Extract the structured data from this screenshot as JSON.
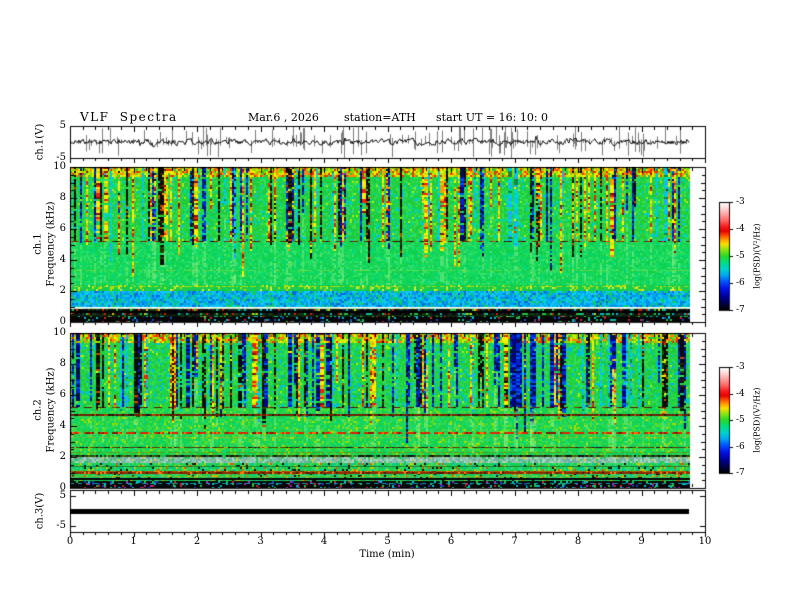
{
  "header": {
    "title": "VLF Spectra",
    "date": "Mar.6 , 2026",
    "station": "station=ATH",
    "start_ut": "start UT =  16: 10: 0"
  },
  "x_axis": {
    "label": "Time (min)",
    "ticks": [
      "0",
      "1",
      "2",
      "3",
      "4",
      "5",
      "6",
      "7",
      "8",
      "9",
      "10"
    ],
    "minor_per_major": 5
  },
  "panels": {
    "ch1_wave": {
      "ylabel": "ch.1(V)",
      "yticks": [
        "5",
        "-5"
      ]
    },
    "spec1": {
      "ylabel_channel": "ch.1",
      "ylabel_axis": "Frequency (kHz)",
      "yticks": [
        "10",
        "8",
        "6",
        "4",
        "2",
        "0"
      ]
    },
    "spec2": {
      "ylabel_channel": "ch.2",
      "ylabel_axis": "Frequency (kHz)",
      "yticks": [
        "10",
        "8",
        "6",
        "4",
        "2",
        "0"
      ]
    },
    "ch3_wave": {
      "ylabel": "ch.3(V)",
      "yticks": [
        "5",
        "-5"
      ]
    }
  },
  "colorbar": {
    "label": "log(PSD)(V²/Hz)",
    "ticks": [
      "-3",
      "-4",
      "-5",
      "-6",
      "-7"
    ],
    "gradient": [
      [
        0.0,
        "#ffffff"
      ],
      [
        0.04,
        "#ffe8e8"
      ],
      [
        0.1,
        "#ffb0b0"
      ],
      [
        0.17,
        "#ff6868"
      ],
      [
        0.23,
        "#f81818"
      ],
      [
        0.27,
        "#e80000"
      ],
      [
        0.31,
        "#ff4c00"
      ],
      [
        0.35,
        "#ffa000"
      ],
      [
        0.39,
        "#f8e000"
      ],
      [
        0.44,
        "#90e410"
      ],
      [
        0.5,
        "#28d828"
      ],
      [
        0.56,
        "#00dc80"
      ],
      [
        0.62,
        "#00d4cc"
      ],
      [
        0.68,
        "#00a4f0"
      ],
      [
        0.74,
        "#0050ff"
      ],
      [
        0.8,
        "#0014e8"
      ],
      [
        0.87,
        "#0000a0"
      ],
      [
        0.93,
        "#000050"
      ],
      [
        1.0,
        "#000000"
      ]
    ]
  },
  "chart_data": [
    {
      "type": "line",
      "name": "ch1_waveform",
      "ylabel": "ch.1(V)",
      "xlim": [
        0,
        10
      ],
      "ylim": [
        -5,
        5
      ],
      "yticks": [
        5,
        -5
      ],
      "description": "Noisy broadband ch.1 time series ~0.5-1 V rms about 0 V with frequent impulsive sferic spikes reaching +/-5 V, data extends 0 to ~9.75 min",
      "render": {
        "seed": 20260306,
        "ar": 0.55,
        "step_v": 1.5,
        "clamp_v": 4.8,
        "spike_count": 170,
        "spike_min_v": 0.5,
        "spike_max_v": 4.6,
        "trace_color": "#111111",
        "spike_color": "#7d7d7d"
      }
    },
    {
      "type": "heatmap",
      "name": "ch1_spectrogram",
      "channel": "ch.1",
      "ylabel": "Frequency (kHz)",
      "xlim": [
        0,
        10
      ],
      "ylim": [
        0,
        10
      ],
      "zlim": [
        -7,
        -3
      ],
      "zlabel": "log(PSD)(V²/Hz)",
      "data_end_min": 9.75,
      "description": "VLF spectrogram: green ~-5 background; dense vertical sferic streaks (yellow/red/black/blue) above ~5.2 kHz; dashed dark-red hiss cutoff line at 5.25 kHz; blue band 1-2 kHz; whitish band ~0.9 kHz; black saturated bands below 0.8 kHz",
      "render": {
        "seed": 420001,
        "regions": [
          {
            "f0": 9.3,
            "f1": 10.01,
            "palette": [
              [
                "#88dd00",
                3
              ],
              [
                "#ccee00",
                2
              ],
              [
                "#ff8800",
                2
              ],
              [
                "#ee3300",
                2
              ],
              [
                "#22cc44",
                2
              ],
              [
                "#ffee00",
                1
              ]
            ]
          },
          {
            "f0": 5.2,
            "f1": 9.3,
            "palette": [
              [
                "#22d344",
                6
              ],
              [
                "#1fc93f",
                4
              ],
              [
                "#35e050",
                3
              ],
              [
                "#00d8a0",
                1.5
              ],
              [
                "#00c8e0",
                0.7
              ],
              [
                "#aaee00",
                0.5
              ]
            ]
          },
          {
            "f0": 2.45,
            "f1": 5.2,
            "palette": [
              [
                "#14d556",
                6
              ],
              [
                "#1edd60",
                4
              ],
              [
                "#0ed04e",
                3
              ],
              [
                "#00d87c",
                2
              ],
              [
                "#3ae06a",
                2
              ]
            ]
          },
          {
            "f0": 2.0,
            "f1": 2.45,
            "palette": [
              [
                "#16d050",
                5
              ],
              [
                "#18c94a",
                4
              ],
              [
                "#bbdd00",
                1
              ],
              [
                "#ddee33",
                0.7
              ]
            ]
          },
          {
            "f0": 1.0,
            "f1": 2.0,
            "palette": [
              [
                "#00aaee",
                3
              ],
              [
                "#0090e8",
                2
              ],
              [
                "#00d0e8",
                2
              ],
              [
                "#18c0ff",
                2
              ],
              [
                "#11cc66",
                2
              ],
              [
                "#0868d8",
                1
              ]
            ]
          },
          {
            "f0": 0.82,
            "f1": 1.0,
            "palette": [
              [
                "#c8e8cc",
                5
              ],
              [
                "#aed8c0",
                3
              ],
              [
                "#e8f4e8",
                2
              ],
              [
                "#ccdd66",
                1
              ]
            ]
          },
          {
            "f0": 0.3,
            "f1": 0.82,
            "palette": [
              [
                "#0a0a0a",
                5
              ],
              [
                "#1a1a2a",
                2
              ],
              [
                "#123a10",
                1.5
              ],
              [
                "#20c040",
                1.2
              ],
              [
                "#00b8c8",
                0.8
              ],
              [
                "#cc2200",
                0.6
              ],
              [
                "#cccc00",
                0.4
              ]
            ]
          },
          {
            "f0": -0.1,
            "f1": 0.3,
            "palette": [
              [
                "#060606",
                8
              ],
              [
                "#00b8d8",
                0.5
              ],
              [
                "#2244cc",
                0.4
              ],
              [
                "#20c040",
                0.4
              ],
              [
                "#cc2233",
                0.2
              ]
            ]
          }
        ],
        "lines": [
          {
            "kHz": 5.25,
            "color": "#7a1e00",
            "width": 1,
            "dash": [
              7,
              7
            ],
            "jitter": [
              "#2e0a00",
              "#cc4400",
              "#101010"
            ]
          },
          {
            "kHz": 3.35,
            "color": "rgba(170,220,40,0.5)",
            "width": 1,
            "speckle": 0.55
          },
          {
            "kHz": 2.32,
            "color": "rgba(225,230,0,0.7)",
            "width": 1,
            "speckle": 0.5
          },
          {
            "kHz": 0.95,
            "color": "rgba(255,255,255,0.85)",
            "width": 1
          },
          {
            "kHz": 0.62,
            "color": "#000000",
            "width": 2
          },
          {
            "kHz": 0.45,
            "color": "#0a2a08",
            "width": 1
          }
        ],
        "streaks": {
          "count": 150,
          "types": [
            [
              "hot",
              4
            ],
            [
              "dark",
              2.5
            ],
            [
              "blue",
              2
            ],
            [
              "cyan",
              1.5
            ]
          ],
          "palettes": {
            "hot": [
              [
                "#ffee00",
                4
              ],
              [
                "#ff9900",
                2
              ],
              [
                "#ee2200",
                2
              ],
              [
                "#881100",
                1
              ],
              [
                "#ccdd00",
                2
              ]
            ],
            "dark": [
              [
                "#0a0a0a",
                5
              ],
              [
                "#332200",
                1
              ],
              [
                "#224400",
                1
              ],
              [
                "#cc4400",
                0.5
              ]
            ],
            "blue": [
              [
                "#0022cc",
                3
              ],
              [
                "#000088",
                2
              ],
              [
                "#0055ee",
                2
              ],
              [
                "#001144",
                2
              ]
            ],
            "cyan": [
              [
                "#00c8e8",
                4
              ],
              [
                "#00e0c0",
                2
              ],
              [
                "#22aaff",
                2
              ],
              [
                "#118844",
                1
              ]
            ]
          },
          "clusters": []
        }
      }
    },
    {
      "type": "heatmap",
      "name": "ch2_spectrogram",
      "channel": "ch.2",
      "ylabel": "Frequency (kHz)",
      "xlim": [
        0,
        10
      ],
      "ylim": [
        0,
        10
      ],
      "zlim": [
        -7,
        -3
      ],
      "zlabel": "log(PSD)(V²/Hz)",
      "data_end_min": 9.75,
      "description": "VLF spectrogram ch.2: green background with sferic streaks above 5.2 kHz (more blue), dashed cutoff 5.25 kHz, dark-red line 4.7 kHz, bright red dashed line 3.5 kHz, dark line 2.05 kHz, gray-cyan band 1.6-1.95 kHz, orange power-line harmonics ~1 kHz, black bands below 0.4 kHz",
      "render": {
        "seed": 777002,
        "regions": [
          {
            "f0": 9.3,
            "f1": 10.01,
            "palette": [
              [
                "#88dd00",
                3
              ],
              [
                "#ccee00",
                2
              ],
              [
                "#ff8800",
                2
              ],
              [
                "#ee3300",
                1.6
              ],
              [
                "#22cc44",
                2
              ],
              [
                "#ffee00",
                1
              ]
            ]
          },
          {
            "f0": 5.25,
            "f1": 9.3,
            "palette": [
              [
                "#22d344",
                6
              ],
              [
                "#1fc93f",
                3
              ],
              [
                "#30e050",
                3
              ],
              [
                "#00ccb8",
                1.4
              ],
              [
                "#00b8e8",
                1.0
              ],
              [
                "#aaee00",
                0.4
              ]
            ]
          },
          {
            "f0": 2.1,
            "f1": 5.25,
            "palette": [
              [
                "#16d24e",
                6
              ],
              [
                "#2ad95c",
                4
              ],
              [
                "#55dd22",
                2
              ],
              [
                "#00d878",
                1.5
              ],
              [
                "#aadd00",
                0.8
              ]
            ]
          },
          {
            "f0": 1.95,
            "f1": 2.1,
            "palette": [
              [
                "#27430e",
                4
              ],
              [
                "#0c0c0c",
                2
              ],
              [
                "#4a6a00",
                2
              ],
              [
                "#16c040",
                1
              ]
            ]
          },
          {
            "f0": 1.58,
            "f1": 1.95,
            "palette": [
              [
                "#8cc4ae",
                4
              ],
              [
                "#70b0a0",
                3
              ],
              [
                "#a8d8c0",
                2
              ],
              [
                "#22cc55",
                1
              ],
              [
                "#cccc44",
                0.5
              ]
            ]
          },
          {
            "f0": 0.42,
            "f1": 1.58,
            "palette": [
              [
                "#18d050",
                5
              ],
              [
                "#33dd66",
                3
              ],
              [
                "#00c8a8",
                1.5
              ],
              [
                "#cccc00",
                0.7
              ],
              [
                "#cc6600",
                0.5
              ],
              [
                "#111111",
                0.8
              ]
            ]
          },
          {
            "f0": -0.1,
            "f1": 0.42,
            "palette": [
              [
                "#070707",
                7
              ],
              [
                "#00c0d0",
                0.6
              ],
              [
                "#22c044",
                0.5
              ],
              [
                "#2233bb",
                0.4
              ],
              [
                "#aa22cc",
                0.35
              ],
              [
                "#cc2233",
                0.25
              ]
            ]
          }
        ],
        "lines": [
          {
            "kHz": 5.25,
            "color": "#5a1600",
            "width": 1,
            "dash": [
              7,
              7
            ],
            "jitter": [
              "#101010",
              "#993300"
            ]
          },
          {
            "kHz": 4.8,
            "color": "rgba(210,200,0,0.5)",
            "width": 1,
            "speckle": 0.5
          },
          {
            "kHz": 4.68,
            "color": "#6e2000",
            "width": 2,
            "jitter": [
              "#3a1000",
              "#b04400",
              "#101010"
            ]
          },
          {
            "kHz": 3.52,
            "color": "#e02200",
            "width": 2,
            "dash": [
              9,
              5
            ],
            "jitter": [
              "#ff6600",
              "#881100"
            ]
          },
          {
            "kHz": 3.3,
            "color": "rgba(255,150,0,0.45)",
            "width": 1,
            "speckle": 0.5
          },
          {
            "kHz": 2.62,
            "color": "#4a3c00",
            "width": 1,
            "jitter": [
              "#caa800",
              "#101010"
            ]
          },
          {
            "kHz": 2.35,
            "color": "rgba(120,120,0,0.6)",
            "width": 1,
            "speckle": 0.8
          },
          {
            "kHz": 1.45,
            "color": "rgba(30,90,20,0.7)",
            "width": 1
          },
          {
            "kHz": 1.12,
            "color": "#b05800",
            "width": 1,
            "jitter": [
              "#ff8800",
              "#7a2a00"
            ]
          },
          {
            "kHz": 0.98,
            "color": "#8a2a00",
            "width": 2,
            "jitter": [
              "#ff7700",
              "#551100"
            ]
          },
          {
            "kHz": 0.8,
            "color": "rgba(200,170,0,0.6)",
            "width": 1,
            "speckle": 0.7
          },
          {
            "kHz": 0.6,
            "color": "#000000",
            "width": 2
          },
          {
            "kHz": 0.3,
            "color": "rgba(0,200,220,0.8)",
            "width": 1,
            "dash": [
              4,
              4
            ]
          }
        ],
        "streaks": {
          "count": 150,
          "types": [
            [
              "hot",
              3
            ],
            [
              "dark",
              2.5
            ],
            [
              "blue",
              3
            ],
            [
              "cyan",
              1.5
            ]
          ],
          "palettes": {
            "hot": [
              [
                "#ffee00",
                4
              ],
              [
                "#ff9900",
                2
              ],
              [
                "#ee2200",
                2
              ],
              [
                "#881100",
                1
              ],
              [
                "#ccdd00",
                2
              ]
            ],
            "dark": [
              [
                "#0a0a0a",
                5
              ],
              [
                "#332200",
                1
              ],
              [
                "#224400",
                1
              ],
              [
                "#cc4400",
                0.5
              ]
            ],
            "blue": [
              [
                "#0022cc",
                3
              ],
              [
                "#000088",
                2
              ],
              [
                "#0055ee",
                2
              ],
              [
                "#001144",
                2
              ]
            ],
            "cyan": [
              [
                "#00c8e8",
                4
              ],
              [
                "#00e0c0",
                2
              ],
              [
                "#22aaff",
                2
              ],
              [
                "#118844",
                1
              ]
            ]
          },
          "clusters": [
            {
              "x0_min": 6.9,
              "x1_min": 7.8,
              "count": 8,
              "type": "blue",
              "width": 4
            }
          ]
        }
      }
    },
    {
      "type": "line",
      "name": "ch3_waveform",
      "ylabel": "ch.3(V)",
      "xlim": [
        0,
        10
      ],
      "ylim": [
        -7,
        7
      ],
      "yticks": [
        5,
        -5
      ],
      "description": "ch.3 flat/saturated trace: solid thick black band just above 0 V extending from 0 to ~9.75 min",
      "render": {
        "bar_color": "#000000",
        "bar_v": [
          0.6,
          -1.0
        ]
      }
    }
  ]
}
